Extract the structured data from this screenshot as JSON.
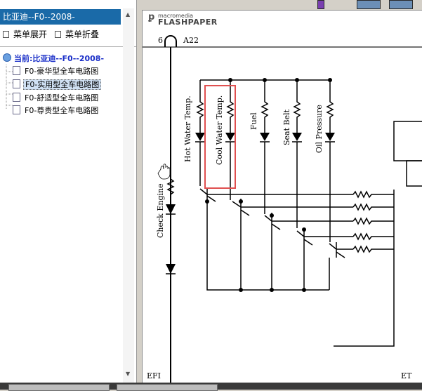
{
  "left_panel": {
    "title": "比亚迪--F0--2008-",
    "expand_label": "菜单展开",
    "collapse_label": "菜单折叠",
    "root_label": "当前:比亚迪--F0--2008-",
    "items": [
      {
        "label": "F0-豪华型全车电路图",
        "selected": false
      },
      {
        "label": "F0-实用型全车电路图",
        "selected": true
      },
      {
        "label": "F0-舒适型全车电路图",
        "selected": false
      },
      {
        "label": "F0-尊贵型全车电路图",
        "selected": false
      }
    ]
  },
  "viewer": {
    "brand_small": "macromedia",
    "brand_large": "FLASHPAPER",
    "diagram": {
      "top_connector": "6",
      "top_connector_label": "A22",
      "labels": [
        "Hot Water Temp.",
        "Cool Water Temp.",
        "Fuel",
        "Seat Belt",
        "Oil Pressure",
        "Check Engine"
      ],
      "bottom_left": "EFI",
      "bottom_right": "ET"
    }
  },
  "colors": {
    "title_bg": "#1a6aa8",
    "highlight": "#e05050",
    "tree_root": "#1a2fc8"
  }
}
